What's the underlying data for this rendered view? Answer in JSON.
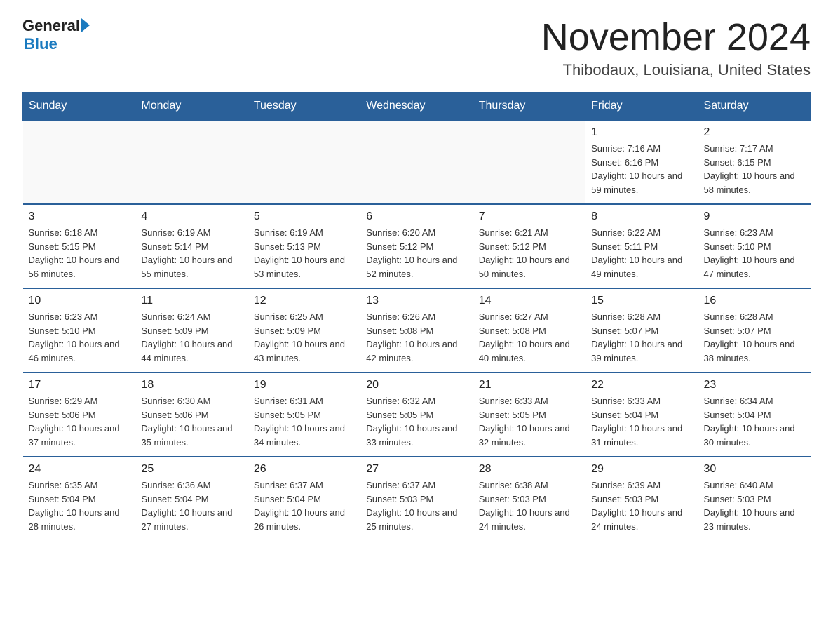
{
  "logo": {
    "general": "General",
    "blue": "Blue"
  },
  "title": "November 2024",
  "subtitle": "Thibodaux, Louisiana, United States",
  "days_of_week": [
    "Sunday",
    "Monday",
    "Tuesday",
    "Wednesday",
    "Thursday",
    "Friday",
    "Saturday"
  ],
  "weeks": [
    [
      {
        "day": "",
        "info": ""
      },
      {
        "day": "",
        "info": ""
      },
      {
        "day": "",
        "info": ""
      },
      {
        "day": "",
        "info": ""
      },
      {
        "day": "",
        "info": ""
      },
      {
        "day": "1",
        "info": "Sunrise: 7:16 AM\nSunset: 6:16 PM\nDaylight: 10 hours and 59 minutes."
      },
      {
        "day": "2",
        "info": "Sunrise: 7:17 AM\nSunset: 6:15 PM\nDaylight: 10 hours and 58 minutes."
      }
    ],
    [
      {
        "day": "3",
        "info": "Sunrise: 6:18 AM\nSunset: 5:15 PM\nDaylight: 10 hours and 56 minutes."
      },
      {
        "day": "4",
        "info": "Sunrise: 6:19 AM\nSunset: 5:14 PM\nDaylight: 10 hours and 55 minutes."
      },
      {
        "day": "5",
        "info": "Sunrise: 6:19 AM\nSunset: 5:13 PM\nDaylight: 10 hours and 53 minutes."
      },
      {
        "day": "6",
        "info": "Sunrise: 6:20 AM\nSunset: 5:12 PM\nDaylight: 10 hours and 52 minutes."
      },
      {
        "day": "7",
        "info": "Sunrise: 6:21 AM\nSunset: 5:12 PM\nDaylight: 10 hours and 50 minutes."
      },
      {
        "day": "8",
        "info": "Sunrise: 6:22 AM\nSunset: 5:11 PM\nDaylight: 10 hours and 49 minutes."
      },
      {
        "day": "9",
        "info": "Sunrise: 6:23 AM\nSunset: 5:10 PM\nDaylight: 10 hours and 47 minutes."
      }
    ],
    [
      {
        "day": "10",
        "info": "Sunrise: 6:23 AM\nSunset: 5:10 PM\nDaylight: 10 hours and 46 minutes."
      },
      {
        "day": "11",
        "info": "Sunrise: 6:24 AM\nSunset: 5:09 PM\nDaylight: 10 hours and 44 minutes."
      },
      {
        "day": "12",
        "info": "Sunrise: 6:25 AM\nSunset: 5:09 PM\nDaylight: 10 hours and 43 minutes."
      },
      {
        "day": "13",
        "info": "Sunrise: 6:26 AM\nSunset: 5:08 PM\nDaylight: 10 hours and 42 minutes."
      },
      {
        "day": "14",
        "info": "Sunrise: 6:27 AM\nSunset: 5:08 PM\nDaylight: 10 hours and 40 minutes."
      },
      {
        "day": "15",
        "info": "Sunrise: 6:28 AM\nSunset: 5:07 PM\nDaylight: 10 hours and 39 minutes."
      },
      {
        "day": "16",
        "info": "Sunrise: 6:28 AM\nSunset: 5:07 PM\nDaylight: 10 hours and 38 minutes."
      }
    ],
    [
      {
        "day": "17",
        "info": "Sunrise: 6:29 AM\nSunset: 5:06 PM\nDaylight: 10 hours and 37 minutes."
      },
      {
        "day": "18",
        "info": "Sunrise: 6:30 AM\nSunset: 5:06 PM\nDaylight: 10 hours and 35 minutes."
      },
      {
        "day": "19",
        "info": "Sunrise: 6:31 AM\nSunset: 5:05 PM\nDaylight: 10 hours and 34 minutes."
      },
      {
        "day": "20",
        "info": "Sunrise: 6:32 AM\nSunset: 5:05 PM\nDaylight: 10 hours and 33 minutes."
      },
      {
        "day": "21",
        "info": "Sunrise: 6:33 AM\nSunset: 5:05 PM\nDaylight: 10 hours and 32 minutes."
      },
      {
        "day": "22",
        "info": "Sunrise: 6:33 AM\nSunset: 5:04 PM\nDaylight: 10 hours and 31 minutes."
      },
      {
        "day": "23",
        "info": "Sunrise: 6:34 AM\nSunset: 5:04 PM\nDaylight: 10 hours and 30 minutes."
      }
    ],
    [
      {
        "day": "24",
        "info": "Sunrise: 6:35 AM\nSunset: 5:04 PM\nDaylight: 10 hours and 28 minutes."
      },
      {
        "day": "25",
        "info": "Sunrise: 6:36 AM\nSunset: 5:04 PM\nDaylight: 10 hours and 27 minutes."
      },
      {
        "day": "26",
        "info": "Sunrise: 6:37 AM\nSunset: 5:04 PM\nDaylight: 10 hours and 26 minutes."
      },
      {
        "day": "27",
        "info": "Sunrise: 6:37 AM\nSunset: 5:03 PM\nDaylight: 10 hours and 25 minutes."
      },
      {
        "day": "28",
        "info": "Sunrise: 6:38 AM\nSunset: 5:03 PM\nDaylight: 10 hours and 24 minutes."
      },
      {
        "day": "29",
        "info": "Sunrise: 6:39 AM\nSunset: 5:03 PM\nDaylight: 10 hours and 24 minutes."
      },
      {
        "day": "30",
        "info": "Sunrise: 6:40 AM\nSunset: 5:03 PM\nDaylight: 10 hours and 23 minutes."
      }
    ]
  ]
}
